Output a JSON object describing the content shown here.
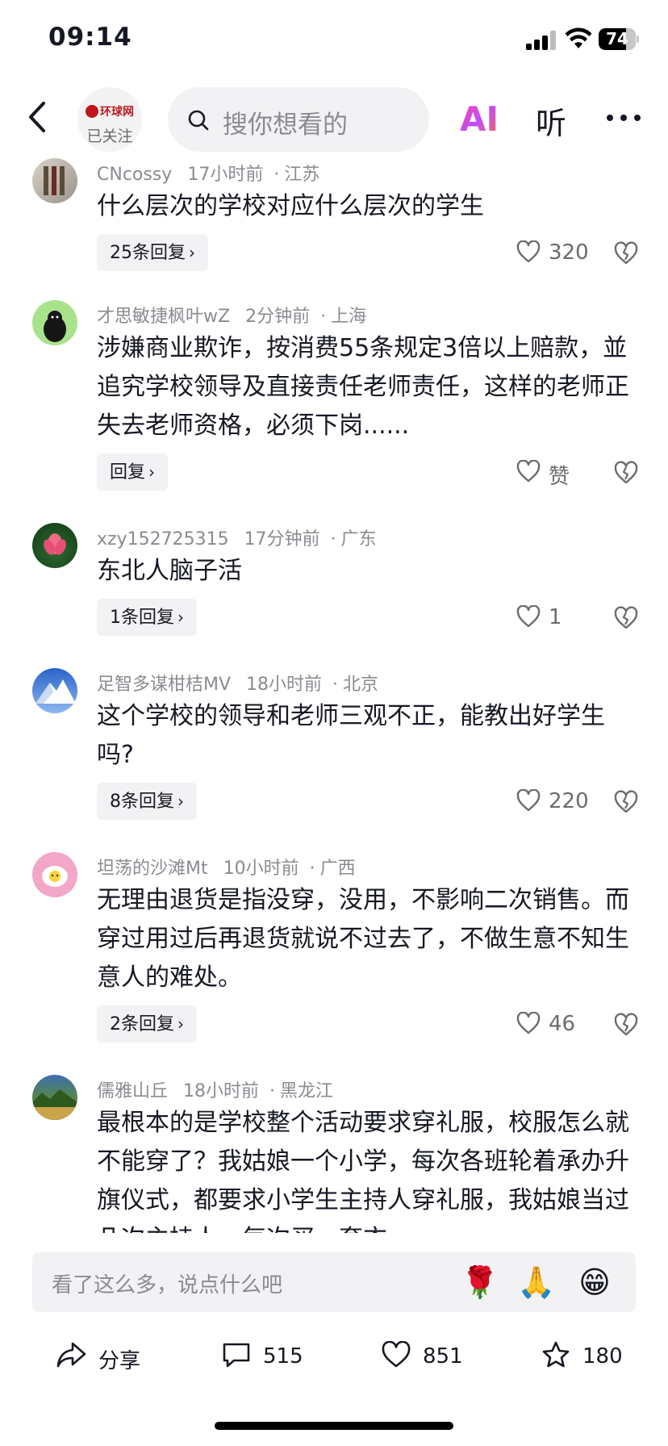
{
  "status": {
    "time": "09:14",
    "battery": "74",
    "battery_level": 0.74
  },
  "header": {
    "account_logo": "环球网",
    "follow_state": "已关注",
    "search_placeholder": "搜你想看的",
    "ai_label": "AI",
    "listen_label": "听"
  },
  "comments": [
    {
      "user": "CNcossy",
      "time": "17小时前",
      "location": "江苏",
      "text": "什么层次的学校对应什么层次的学生",
      "reply": "25条回复",
      "likes": "320"
    },
    {
      "user": "才思敏捷枫叶wZ",
      "time": "2分钟前",
      "location": "上海",
      "text": "涉嫌商业欺诈，按消费55条规定3倍以上赔款，並追究学校领导及直接责任老师责任，这样的老师正失去老师资格，必须下岗......",
      "reply": "回复",
      "likes": "赞"
    },
    {
      "user": "xzy152725315",
      "time": "17分钟前",
      "location": "广东",
      "text": "东北人脑子活",
      "reply": "1条回复",
      "likes": "1"
    },
    {
      "user": "足智多谋柑桔MV",
      "time": "18小时前",
      "location": "北京",
      "text": "这个学校的领导和老师三观不正，能教出好学生吗?",
      "reply": "8条回复",
      "likes": "220"
    },
    {
      "user": "坦荡的沙滩Mt",
      "time": "10小时前",
      "location": "广西",
      "text": "无理由退货是指没穿，没用，不影响二次销售。而穿过用过后再退货就说不过去了，不做生意不知生意人的难处。",
      "reply": "2条回复",
      "likes": "46"
    },
    {
      "user": "儒雅山丘",
      "time": "18小时前",
      "location": "黑龙江",
      "text": "最根本的是学校整个活动要求穿礼服，校服怎么就不能穿了？我姑娘一个小学，每次各班轮着承办升旗仪式，都要求小学生主持人穿礼服，我姑娘当过几次主持人，每次买一套衣",
      "reply": "",
      "likes": ""
    }
  ],
  "input": {
    "placeholder": "看了这么多，说点什么吧",
    "emojis": [
      "🌹",
      "🙏",
      "😁"
    ]
  },
  "bottom": {
    "share": "分享",
    "comments": "515",
    "likes": "851",
    "favorites": "180"
  }
}
